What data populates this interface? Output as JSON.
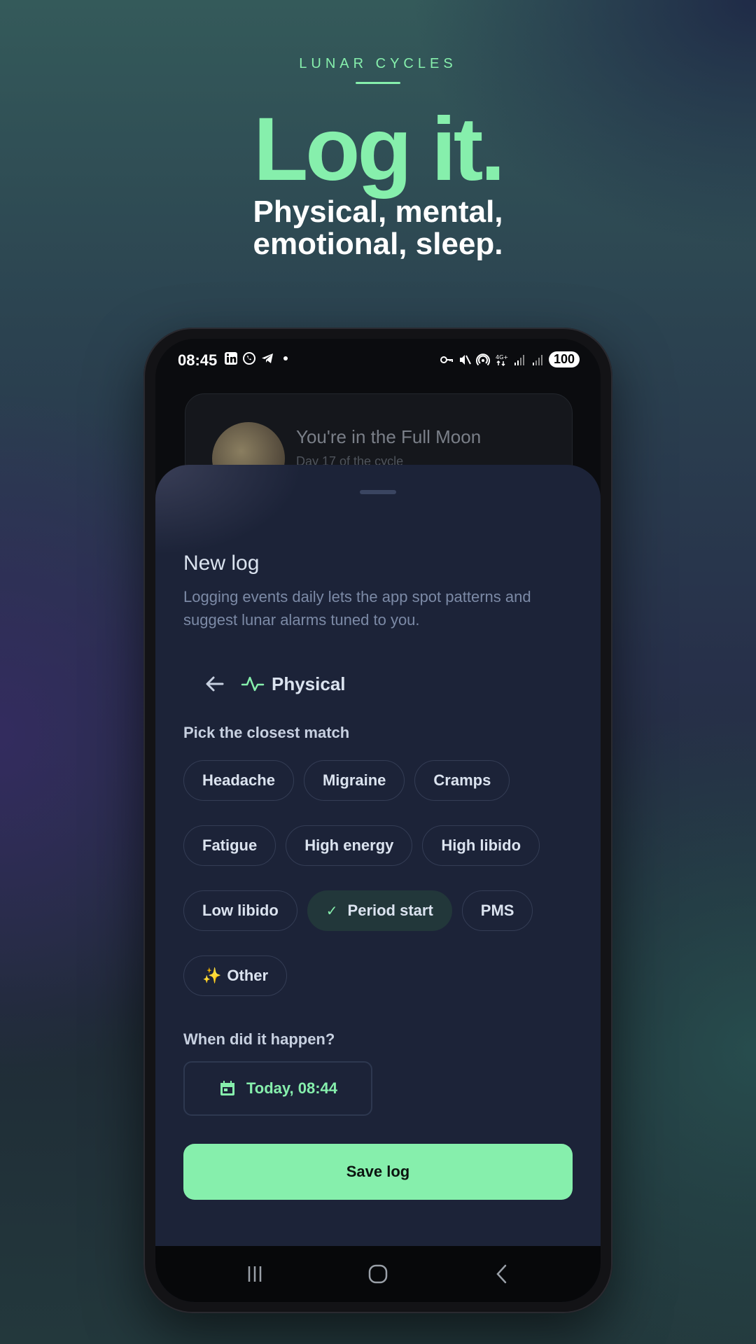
{
  "brand": {
    "label": "LUNAR CYCLES"
  },
  "hero": {
    "headline": "Log it.",
    "subhead_line1": "Physical, mental,",
    "subhead_line2": "emotional, sleep."
  },
  "status_bar": {
    "time": "08:45",
    "left_icons": [
      "linkedin-icon",
      "whatsapp-icon",
      "telegram-icon",
      "dot-icon"
    ],
    "right_icons": [
      "key-icon",
      "mute-icon",
      "hotspot-icon",
      "4g-icon",
      "signal-icon",
      "signal-icon"
    ],
    "network": "4G+",
    "battery": "100"
  },
  "moon_card": {
    "title": "You're in the Full Moon",
    "subtitle": "Day 17 of the cycle"
  },
  "sheet": {
    "title": "New log",
    "description": "Logging events daily lets the app spot patterns and suggest lunar alarms tuned to you.",
    "category": {
      "label": "Physical",
      "icon": "activity-pulse-icon"
    },
    "pick_label": "Pick the closest match",
    "chip_rows": [
      [
        {
          "label": "Headache",
          "selected": false
        },
        {
          "label": "Migraine",
          "selected": false
        },
        {
          "label": "Cramps",
          "selected": false
        }
      ],
      [
        {
          "label": "Fatigue",
          "selected": false
        },
        {
          "label": "High energy",
          "selected": false
        },
        {
          "label": "High libido",
          "selected": false
        }
      ],
      [
        {
          "label": "Low libido",
          "selected": false
        },
        {
          "label": "Period start",
          "selected": true
        },
        {
          "label": "PMS",
          "selected": false
        }
      ],
      [
        {
          "label": "Other",
          "selected": false,
          "emoji": "✨"
        }
      ]
    ],
    "when_label": "When did it happen?",
    "date_value": "Today, 08:44",
    "save_label": "Save log"
  },
  "nav_bar": {
    "buttons": [
      "recents-icon",
      "home-icon",
      "back-icon"
    ]
  },
  "colors": {
    "accent": "#86efac",
    "sheet_bg": "#1c2338",
    "selected_chip_bg": "#22373a"
  }
}
